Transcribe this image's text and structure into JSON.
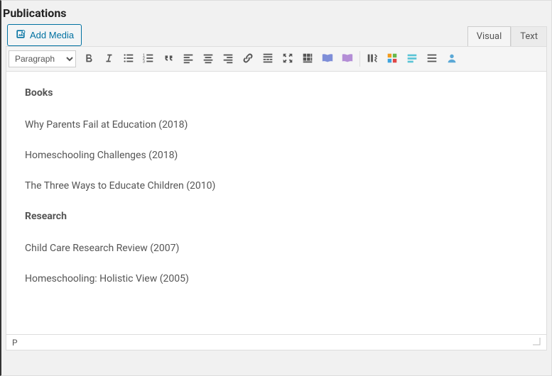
{
  "header": {
    "title": "Publications"
  },
  "toolbar": {
    "addMedia": "Add Media",
    "formatSelect": "Paragraph"
  },
  "tabs": {
    "visual": "Visual",
    "text": "Text",
    "active": "visual"
  },
  "icons": {
    "bold": "bold-icon",
    "italic": "italic-icon",
    "ul": "bullet-list-icon",
    "ol": "numbered-list-icon",
    "blockquote": "blockquote-icon",
    "alignLeft": "align-left-icon",
    "alignCenter": "align-center-icon",
    "alignRight": "align-right-icon",
    "link": "link-icon",
    "more": "read-more-icon",
    "fullscreen": "fullscreen-icon",
    "toolbarToggle": "toolbar-toggle-icon",
    "book1": "book-open-icon",
    "book2": "book-open-solid-icon",
    "columns": "insert-column-icon",
    "colorBlocks": "color-blocks-icon",
    "highlight": "highlight-icon",
    "hamburger": "hamburger-icon",
    "user": "user-icon"
  },
  "content": {
    "sections": [
      {
        "heading": "Books",
        "items": [
          "Why Parents Fail at Education (2018)",
          "Homeschooling Challenges (2018)",
          "The Three Ways to Educate Children (2010)"
        ]
      },
      {
        "heading": "Research",
        "items": [
          "Child Care Research Review (2007)",
          "Homeschooling: Holistic View (2005)"
        ]
      }
    ]
  },
  "statusbar": {
    "path": "P"
  }
}
